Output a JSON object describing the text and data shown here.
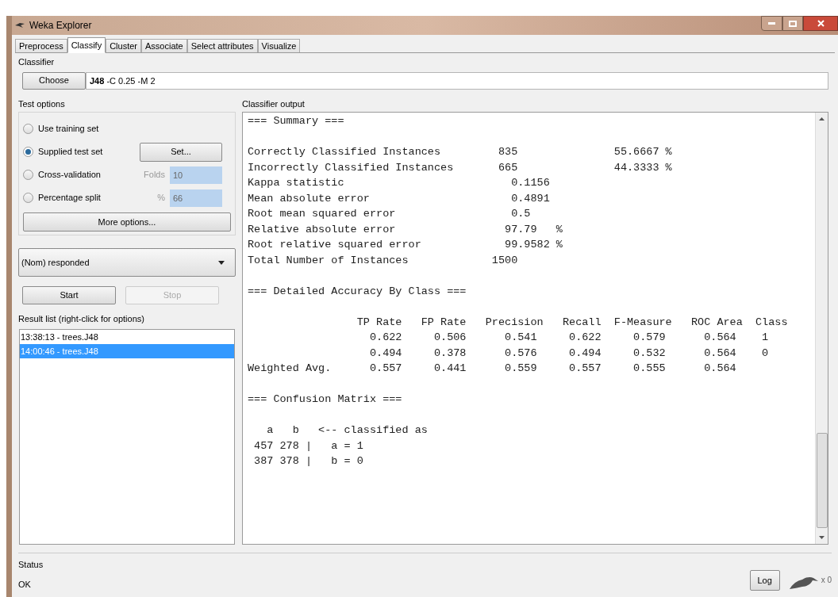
{
  "window": {
    "title": "Weka Explorer"
  },
  "tabs": [
    {
      "label": "Preprocess",
      "selected": false
    },
    {
      "label": "Classify",
      "selected": true
    },
    {
      "label": "Cluster",
      "selected": false
    },
    {
      "label": "Associate",
      "selected": false
    },
    {
      "label": "Select attributes",
      "selected": false
    },
    {
      "label": "Visualize",
      "selected": false
    }
  ],
  "classifier": {
    "label": "Classifier",
    "choose_button": "Choose",
    "spec": "**J48** -C 0.25 -M 2"
  },
  "test_options": {
    "label": "Test options",
    "options": [
      {
        "label": "Use training set",
        "selected": false
      },
      {
        "label": "Supplied test set",
        "selected": true,
        "control": {
          "kind": "button",
          "label": "Set..."
        }
      },
      {
        "label": "Cross-validation",
        "selected": false,
        "control": {
          "kind": "field",
          "label": "Folds",
          "value": "10"
        }
      },
      {
        "label": "Percentage split",
        "selected": false,
        "control": {
          "kind": "field",
          "label": "%",
          "value": "66"
        }
      }
    ],
    "more_button": "More options..."
  },
  "class_selector": "(Nom) responded",
  "run_buttons": [
    {
      "label": "Start",
      "disabled": false
    },
    {
      "label": "Stop",
      "disabled": true
    }
  ],
  "result_list": {
    "label": "Result list (right-click for options)",
    "items": [
      {
        "text": "13:38:13 - trees.J48",
        "selected": false
      },
      {
        "text": "14:00:46 - trees.J48",
        "selected": true
      }
    ]
  },
  "output": {
    "label": "Classifier output",
    "blocks": [
      [
        "=== Summary ==="
      ],
      [
        "Correctly Classified Instances         835               55.6667 %",
        "Incorrectly Classified Instances       665               44.3333 %",
        "Kappa statistic                          0.1156",
        "Mean absolute error                      0.4891",
        "Root mean squared error                  0.5",
        "Relative absolute error                 97.79   %",
        "Root relative squared error             99.9582 %",
        "Total Number of Instances             1500"
      ],
      [
        "=== Detailed Accuracy By Class ==="
      ],
      [
        "                 TP Rate   FP Rate   Precision   Recall  F-Measure   ROC Area  Class",
        "                   0.622     0.506      0.541     0.622     0.579      0.564    1",
        "                   0.494     0.378      0.576     0.494     0.532      0.564    0",
        "Weighted Avg.      0.557     0.441      0.559     0.557     0.555      0.564"
      ],
      [
        "=== Confusion Matrix ==="
      ],
      [
        "   a   b   <-- classified as",
        " 457 278 |   a = 1",
        " 387 378 |   b = 0"
      ]
    ]
  },
  "status": {
    "label": "Status",
    "message": "OK",
    "log_button": "Log",
    "count": "x 0"
  }
}
